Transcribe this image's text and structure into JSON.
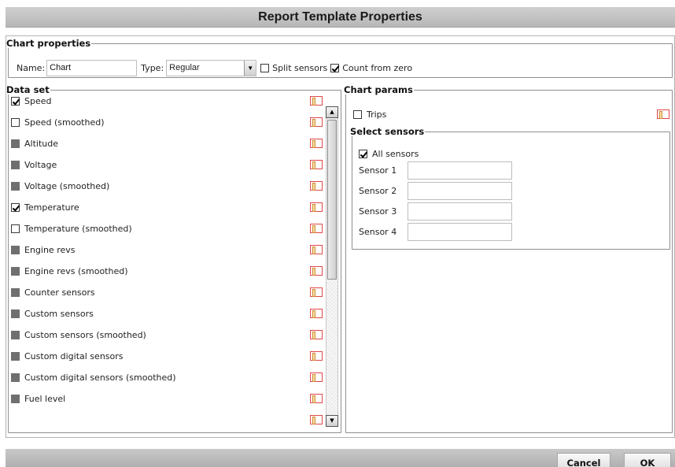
{
  "dialog": {
    "title": "Report Template Properties"
  },
  "chart_properties": {
    "legend": "Chart properties",
    "name_label": "Name:",
    "name_value": "Chart",
    "type_label": "Type:",
    "type_value": "Regular",
    "split_sensors": {
      "label": "Split sensors",
      "checked": false
    },
    "count_from_zero": {
      "label": "Count from zero",
      "checked": true
    }
  },
  "data_set": {
    "legend": "Data set",
    "items": [
      {
        "label": "Speed",
        "state": "checked"
      },
      {
        "label": "Speed (smoothed)",
        "state": "unchecked"
      },
      {
        "label": "Altitude",
        "state": "disabled"
      },
      {
        "label": "Voltage",
        "state": "disabled"
      },
      {
        "label": "Voltage (smoothed)",
        "state": "disabled"
      },
      {
        "label": "Temperature",
        "state": "checked"
      },
      {
        "label": "Temperature (smoothed)",
        "state": "unchecked"
      },
      {
        "label": "Engine revs",
        "state": "disabled"
      },
      {
        "label": "Engine revs (smoothed)",
        "state": "disabled"
      },
      {
        "label": "Counter sensors",
        "state": "disabled"
      },
      {
        "label": "Custom sensors",
        "state": "disabled"
      },
      {
        "label": "Custom sensors (smoothed)",
        "state": "disabled"
      },
      {
        "label": "Custom digital sensors",
        "state": "disabled"
      },
      {
        "label": "Custom digital sensors (smoothed)",
        "state": "disabled"
      },
      {
        "label": "Fuel level",
        "state": "disabled"
      }
    ]
  },
  "chart_params": {
    "legend": "Chart params",
    "trips": {
      "label": "Trips",
      "checked": false
    }
  },
  "select_sensors": {
    "legend": "Select sensors",
    "all_sensors": {
      "label": "All sensors",
      "checked": true
    },
    "sensors": [
      {
        "label": "Sensor 1",
        "value": ""
      },
      {
        "label": "Sensor 2",
        "value": ""
      },
      {
        "label": "Sensor 3",
        "value": ""
      },
      {
        "label": "Sensor 4",
        "value": ""
      }
    ]
  },
  "buttons": {
    "cancel": "Cancel",
    "ok": "OK"
  },
  "colors": {
    "swatch_border": "#e04848",
    "title_bar": "#c2c2c2"
  },
  "icons": {
    "color_picker": "color-swatch-icon",
    "scroll_up": "arrow-up-icon",
    "scroll_down": "arrow-down-icon"
  }
}
